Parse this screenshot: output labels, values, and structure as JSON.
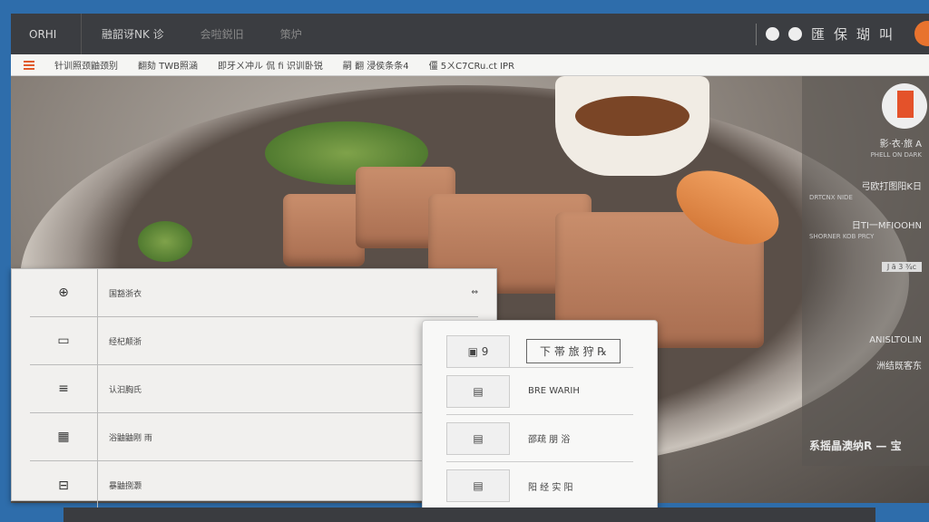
{
  "topbar": {
    "brand": "ORHI",
    "nav": [
      "融韶讶NK 诊",
      "会啦鋭旧",
      "策炉"
    ],
    "right_labels": [
      "匯",
      "保",
      "瑚",
      "叫"
    ]
  },
  "toolbar": {
    "items": [
      "针训照颈鼬颈别",
      "翻劾 TWB照涵",
      "即牙ㄨ冲ル 侃 fi 识训卧锐",
      "嗣 翻 浸侯条条4",
      "僵 5ㄨC7CRu.ct IPR"
    ]
  },
  "side": {
    "title": "影·衣·旅 A",
    "title_sub": "PHELL ON DARK",
    "l1": "弓欧打图阳K日",
    "l1_sub": "DRTCNX NIDE",
    "l2": "日TI一MFIOOHN",
    "l2_sub": "SHORNER KOB PRCY",
    "tag": "J ä 3 ¾c",
    "l3": "ANISLTOLIN",
    "l4": "洲结既客东",
    "footer": "系摇晶澳纳R — 宝"
  },
  "left_panel": {
    "rows": [
      {
        "icon": "⊕",
        "label": "国豁浙衣",
        "action": "⇔"
      },
      {
        "icon": "▭",
        "label": "经杞颠浙",
        "action": ""
      },
      {
        "icon": "≡",
        "label": "认汩胸氏",
        "action": ""
      },
      {
        "icon": "▦",
        "label": "浴鼬鼬刚 雨",
        "action": ""
      },
      {
        "icon": "⊟",
        "label": "暴鼬捌灏",
        "action": ""
      }
    ]
  },
  "card": {
    "header_icon": "▣ 9",
    "header_label": "下 帯 旅 狩 ℞",
    "rows": [
      {
        "label": "BRE WARIH"
      },
      {
        "label": "邵疏 朋 浴"
      },
      {
        "label": "阳 经 实 阳"
      }
    ]
  }
}
